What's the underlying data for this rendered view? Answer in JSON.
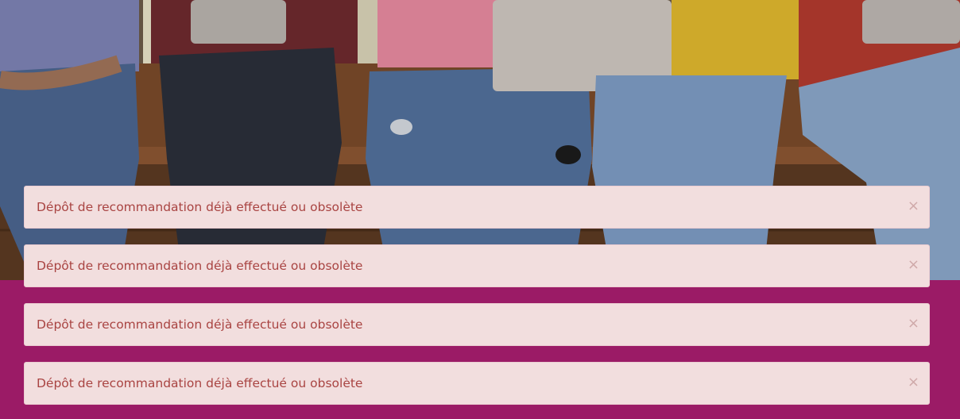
{
  "hero": {
    "image": "students-sitting-on-bench-with-laptops-and-tablets"
  },
  "colors": {
    "page_background": "#9b1b66",
    "alert_background": "#f2dede",
    "alert_text": "#a94442"
  },
  "alerts": [
    {
      "message": "Dépôt de recommandation déjà effectué ou obsolète",
      "close": "×"
    },
    {
      "message": "Dépôt de recommandation déjà effectué ou obsolète",
      "close": "×"
    },
    {
      "message": "Dépôt de recommandation déjà effectué ou obsolète",
      "close": "×"
    },
    {
      "message": "Dépôt de recommandation déjà effectué ou obsolète",
      "close": "×"
    }
  ]
}
